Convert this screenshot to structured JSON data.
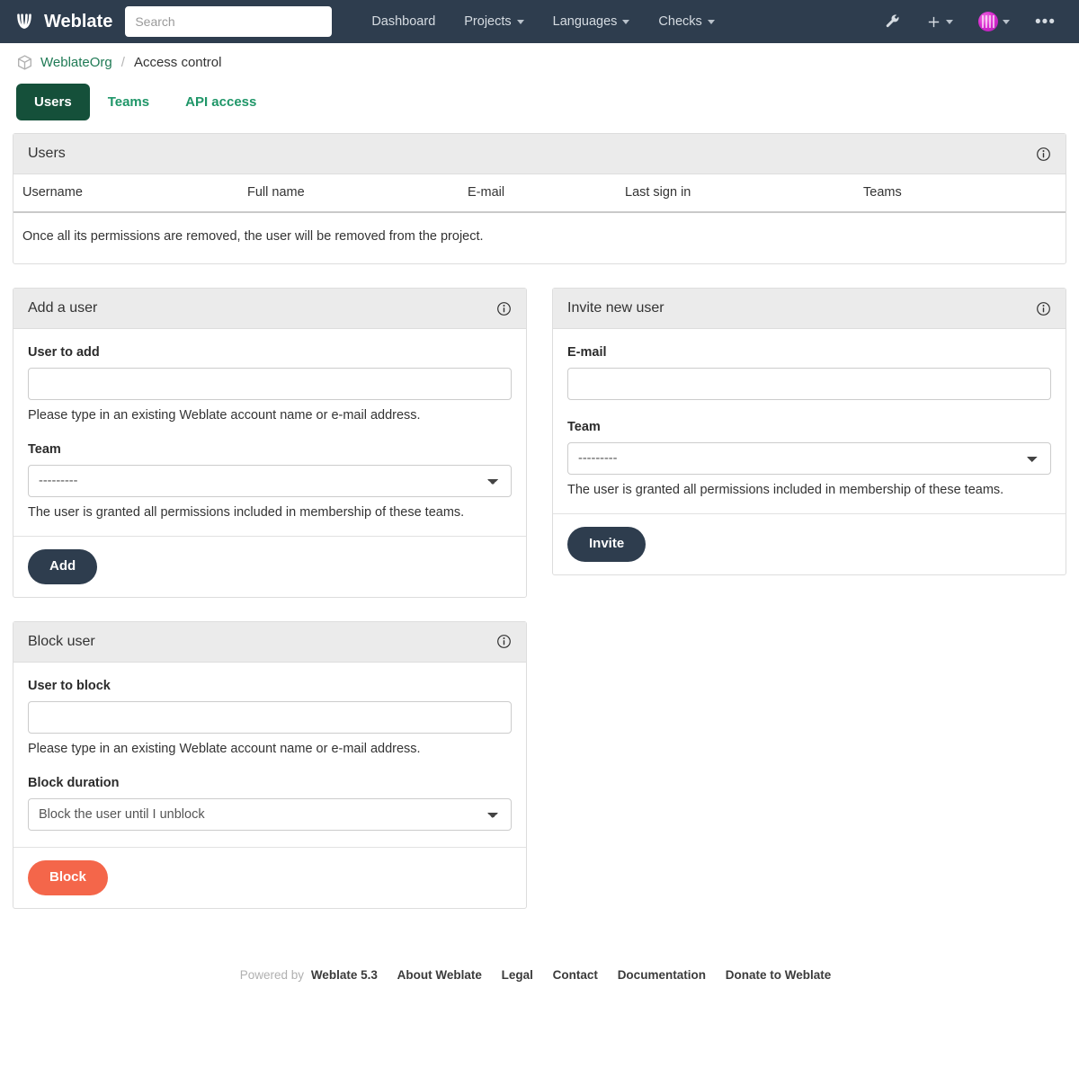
{
  "navbar": {
    "brand": "Weblate",
    "brand_logo_icon": "weblate-logo-icon",
    "search_placeholder": "Search",
    "search_value": "",
    "links": [
      {
        "label": "Dashboard",
        "has_caret": false
      },
      {
        "label": "Projects",
        "has_caret": true
      },
      {
        "label": "Languages",
        "has_caret": true
      },
      {
        "label": "Checks",
        "has_caret": true
      }
    ],
    "tools_icon": "wrench-icon",
    "add_icon": "plus-icon",
    "avatar_icon": "user-avatar",
    "more_icon": "ellipsis-icon",
    "background_color": "#2e3d4e"
  },
  "breadcrumb": {
    "project_icon": "cube-icon",
    "project": "WeblateOrg",
    "separator": "/",
    "current": "Access control"
  },
  "tabs": [
    {
      "label": "Users",
      "active": true
    },
    {
      "label": "Teams",
      "active": false
    },
    {
      "label": "API access",
      "active": false
    }
  ],
  "users_panel": {
    "title": "Users",
    "info_icon": "info-circle-icon",
    "columns": [
      "Username",
      "Full name",
      "E-mail",
      "Last sign in",
      "Teams"
    ],
    "rows": [],
    "empty_message": "Once all its permissions are removed, the user will be removed from the project."
  },
  "add_user_panel": {
    "title": "Add a user",
    "info_icon": "info-circle-icon",
    "user_label": "User to add",
    "user_value": "",
    "user_help": "Please type in an existing Weblate account name or e-mail address.",
    "team_label": "Team",
    "team_value": "---------",
    "team_options": [
      "---------"
    ],
    "team_help": "The user is granted all permissions included in membership of these teams.",
    "submit_label": "Add"
  },
  "invite_panel": {
    "title": "Invite new user",
    "info_icon": "info-circle-icon",
    "email_label": "E-mail",
    "email_value": "",
    "team_label": "Team",
    "team_value": "---------",
    "team_options": [
      "---------"
    ],
    "team_help": "The user is granted all permissions included in membership of these teams.",
    "submit_label": "Invite"
  },
  "block_panel": {
    "title": "Block user",
    "info_icon": "info-circle-icon",
    "user_label": "User to block",
    "user_value": "",
    "user_help": "Please type in an existing Weblate account name or e-mail address.",
    "duration_label": "Block duration",
    "duration_value": "Block the user until I unblock",
    "duration_options": [
      "Block the user until I unblock"
    ],
    "submit_label": "Block"
  },
  "footer": {
    "powered_by": "Powered by",
    "links": [
      "Weblate 5.3",
      "About Weblate",
      "Legal",
      "Contact",
      "Documentation",
      "Donate to Weblate"
    ]
  },
  "colors": {
    "navbar": "#2e3d4e",
    "tab_active": "#15503a",
    "tab_link": "#1f9668",
    "btn_dark": "#2e3d4e",
    "btn_danger": "#f4664a",
    "panel_heading": "#ebebeb"
  }
}
